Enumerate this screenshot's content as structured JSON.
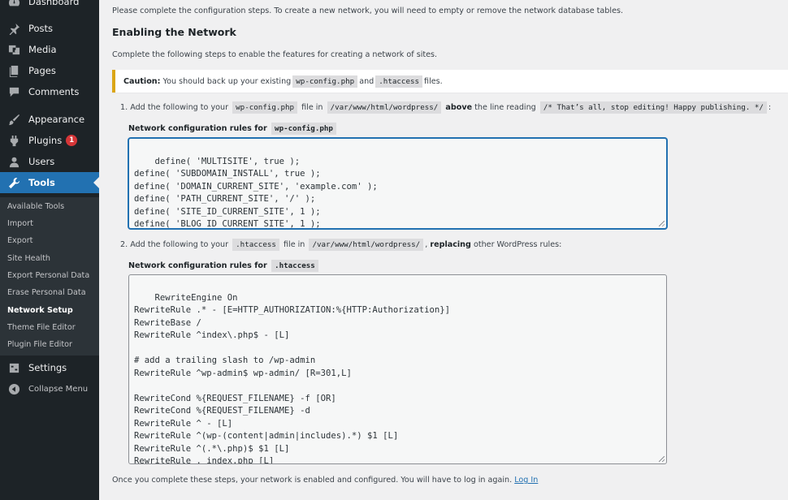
{
  "sidebar": {
    "items": [
      {
        "label": "Dashboard",
        "icon": "dashboard-icon"
      },
      {
        "label": "Posts",
        "icon": "pin-icon"
      },
      {
        "label": "Media",
        "icon": "media-icon"
      },
      {
        "label": "Pages",
        "icon": "pages-icon"
      },
      {
        "label": "Comments",
        "icon": "comment-icon"
      },
      {
        "label": "Appearance",
        "icon": "brush-icon"
      },
      {
        "label": "Plugins",
        "icon": "plugin-icon",
        "badge": "1"
      },
      {
        "label": "Users",
        "icon": "user-icon"
      },
      {
        "label": "Tools",
        "icon": "wrench-icon"
      },
      {
        "label": "Settings",
        "icon": "sliders-icon"
      },
      {
        "label": "Collapse Menu",
        "icon": "collapse-icon"
      }
    ],
    "submenu": [
      "Available Tools",
      "Import",
      "Export",
      "Site Health",
      "Export Personal Data",
      "Erase Personal Data",
      "Network Setup",
      "Theme File Editor",
      "Plugin File Editor"
    ],
    "active_submenu": "Network Setup"
  },
  "main": {
    "intro": "Please complete the configuration steps. To create a new network, you will need to empty or remove the network database tables.",
    "heading": "Enabling the Network",
    "subtitle": "Complete the following steps to enable the features for creating a network of sites.",
    "caution": {
      "label": "Caution:",
      "text1": "You should back up your existing",
      "code1": "wp-config.php",
      "and": "and",
      "code2": ".htaccess",
      "text2": "files."
    },
    "step1": {
      "prefix": "1. Add the following to your",
      "file": "wp-config.php",
      "in": "file in",
      "path": "/var/www/html/wordpress/",
      "above": "above",
      "reading": "the line reading",
      "line": "/* That’s all, stop editing! Happy publishing. */",
      "colon": ":",
      "rules_label": "Network configuration rules for",
      "rules_file": "wp-config.php",
      "code": "define( 'MULTISITE', true );\ndefine( 'SUBDOMAIN_INSTALL', true );\ndefine( 'DOMAIN_CURRENT_SITE', 'example.com' );\ndefine( 'PATH_CURRENT_SITE', '/' );\ndefine( 'SITE_ID_CURRENT_SITE', 1 );\ndefine( 'BLOG_ID_CURRENT_SITE', 1 );"
    },
    "step2": {
      "prefix": "2. Add the following to your",
      "file": ".htaccess",
      "in": "file in",
      "path": "/var/www/html/wordpress/",
      "comma": ",",
      "replacing": "replacing",
      "rest": "other WordPress rules:",
      "rules_label": "Network configuration rules for",
      "rules_file": ".htaccess",
      "code": "RewriteEngine On\nRewriteRule .* - [E=HTTP_AUTHORIZATION:%{HTTP:Authorization}]\nRewriteBase /\nRewriteRule ^index\\.php$ - [L]\n\n# add a trailing slash to /wp-admin\nRewriteRule ^wp-admin$ wp-admin/ [R=301,L]\n\nRewriteCond %{REQUEST_FILENAME} -f [OR]\nRewriteCond %{REQUEST_FILENAME} -d\nRewriteRule ^ - [L]\nRewriteRule ^(wp-(content|admin|includes).*) $1 [L]\nRewriteRule ^(.*\\.php)$ $1 [L]\nRewriteRule . index.php [L]"
    },
    "footer": {
      "text": "Once you complete these steps, your network is enabled and configured. You will have to log in again.",
      "link": "Log In"
    }
  },
  "colors": {
    "sidebar_bg": "#1d2327",
    "submenu_bg": "#2c3338",
    "accent": "#2271b1",
    "badge": "#d63638",
    "caution_border": "#dba617"
  }
}
